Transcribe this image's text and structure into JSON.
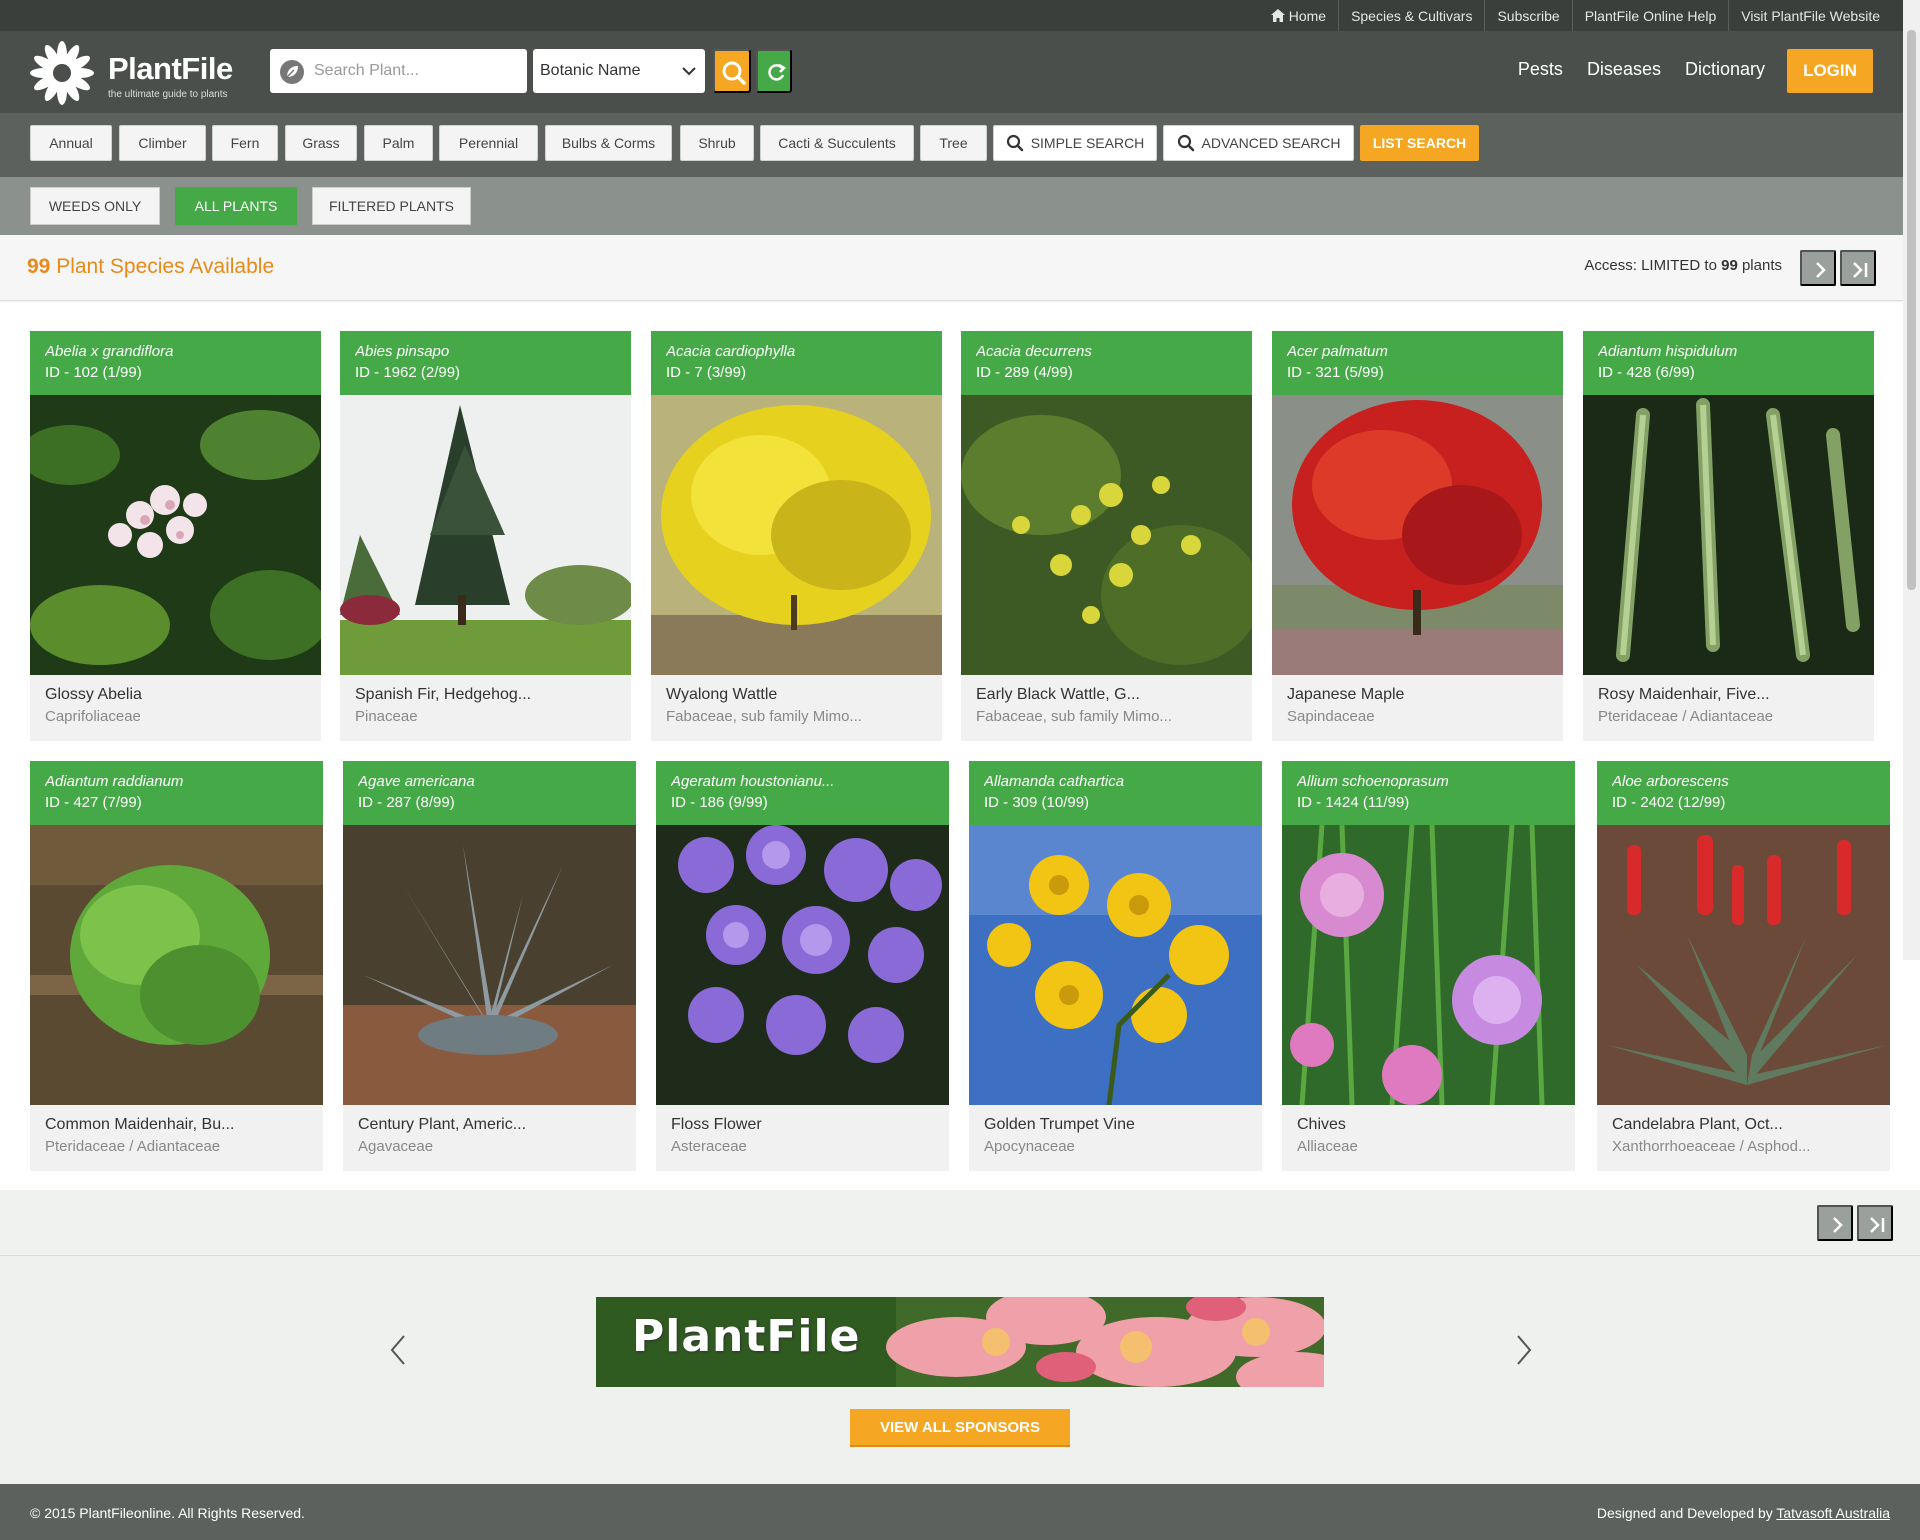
{
  "topbar": {
    "links": [
      "Home",
      "Species & Cultivars",
      "Subscribe",
      "PlantFile Online Help",
      "Visit PlantFile Website"
    ]
  },
  "header": {
    "logo_text": "PlantFile",
    "logo_tagline": "the ultimate guide to plants",
    "search_placeholder": "Search Plant...",
    "search_type": "Botanic Name",
    "nav": [
      "Pests",
      "Diseases",
      "Dictionary"
    ],
    "login_label": "LOGIN"
  },
  "categories": [
    "Annual",
    "Climber",
    "Fern",
    "Grass",
    "Palm",
    "Perennial",
    "Bulbs & Corms",
    "Shrub",
    "Cacti & Succulents",
    "Tree"
  ],
  "search_buttons": {
    "simple": "SIMPLE SEARCH",
    "advanced": "ADVANCED SEARCH",
    "list": "LIST SEARCH"
  },
  "filters": {
    "weeds": "WEEDS ONLY",
    "all": "ALL PLANTS",
    "filtered": "FILTERED PLANTS",
    "active": "ALL PLANTS"
  },
  "summary": {
    "count": "99",
    "title_suffix": "Plant Species Available",
    "access_prefix": "Access: LIMITED to",
    "access_count": "99",
    "access_suffix": "plants"
  },
  "plants": [
    {
      "botanic": "Abelia x grandiflora",
      "id": "ID - 102 (1/99)",
      "common": "Glossy Abelia",
      "family": "Caprifoliaceae"
    },
    {
      "botanic": "Abies pinsapo",
      "id": "ID - 1962 (2/99)",
      "common": "Spanish Fir, Hedgehog...",
      "family": "Pinaceae"
    },
    {
      "botanic": "Acacia cardiophylla",
      "id": "ID - 7 (3/99)",
      "common": "Wyalong Wattle",
      "family": "Fabaceae, sub family Mimo..."
    },
    {
      "botanic": "Acacia decurrens",
      "id": "ID - 289 (4/99)",
      "common": "Early Black Wattle, G...",
      "family": "Fabaceae, sub family Mimo..."
    },
    {
      "botanic": "Acer palmatum",
      "id": "ID - 321 (5/99)",
      "common": "Japanese Maple",
      "family": "Sapindaceae"
    },
    {
      "botanic": "Adiantum hispidulum",
      "id": "ID - 428 (6/99)",
      "common": "Rosy Maidenhair, Five...",
      "family": "Pteridaceae / Adiantaceae"
    },
    {
      "botanic": "Adiantum raddianum",
      "id": "ID - 427 (7/99)",
      "common": "Common Maidenhair, Bu...",
      "family": "Pteridaceae / Adiantaceae"
    },
    {
      "botanic": "Agave americana",
      "id": "ID - 287 (8/99)",
      "common": "Century Plant, Americ...",
      "family": "Agavaceae"
    },
    {
      "botanic": "Ageratum houstonianu...",
      "id": "ID - 186 (9/99)",
      "common": "Floss Flower",
      "family": "Asteraceae"
    },
    {
      "botanic": "Allamanda cathartica",
      "id": "ID - 309 (10/99)",
      "common": "Golden Trumpet Vine",
      "family": "Apocynaceae"
    },
    {
      "botanic": "Allium schoenoprasum",
      "id": "ID - 1424 (11/99)",
      "common": "Chives",
      "family": "Alliaceae"
    },
    {
      "botanic": "Aloe arborescens",
      "id": "ID - 2402 (12/99)",
      "common": "Candelabra Plant, Oct...",
      "family": "Xanthorrhoeaceae / Asphod..."
    }
  ],
  "sponsors": {
    "banner_text": "PlantFile",
    "view_all": "VIEW ALL SPONSORS"
  },
  "footer": {
    "copyright": "© 2015 PlantFileonline. All Rights Reserved.",
    "credit_prefix": "Designed and Developed by",
    "credit_link": "Tatvasoft Australia"
  },
  "colors": {
    "accent_orange": "#f5a623",
    "accent_green": "#46a947",
    "header_dark": "#4a4f4b"
  },
  "icons": [
    "home-icon",
    "leaf-icon",
    "chevron-down-icon",
    "search-icon",
    "refresh-icon",
    "next-page-icon",
    "last-page-icon",
    "prev-arrow-icon",
    "next-arrow-icon"
  ]
}
